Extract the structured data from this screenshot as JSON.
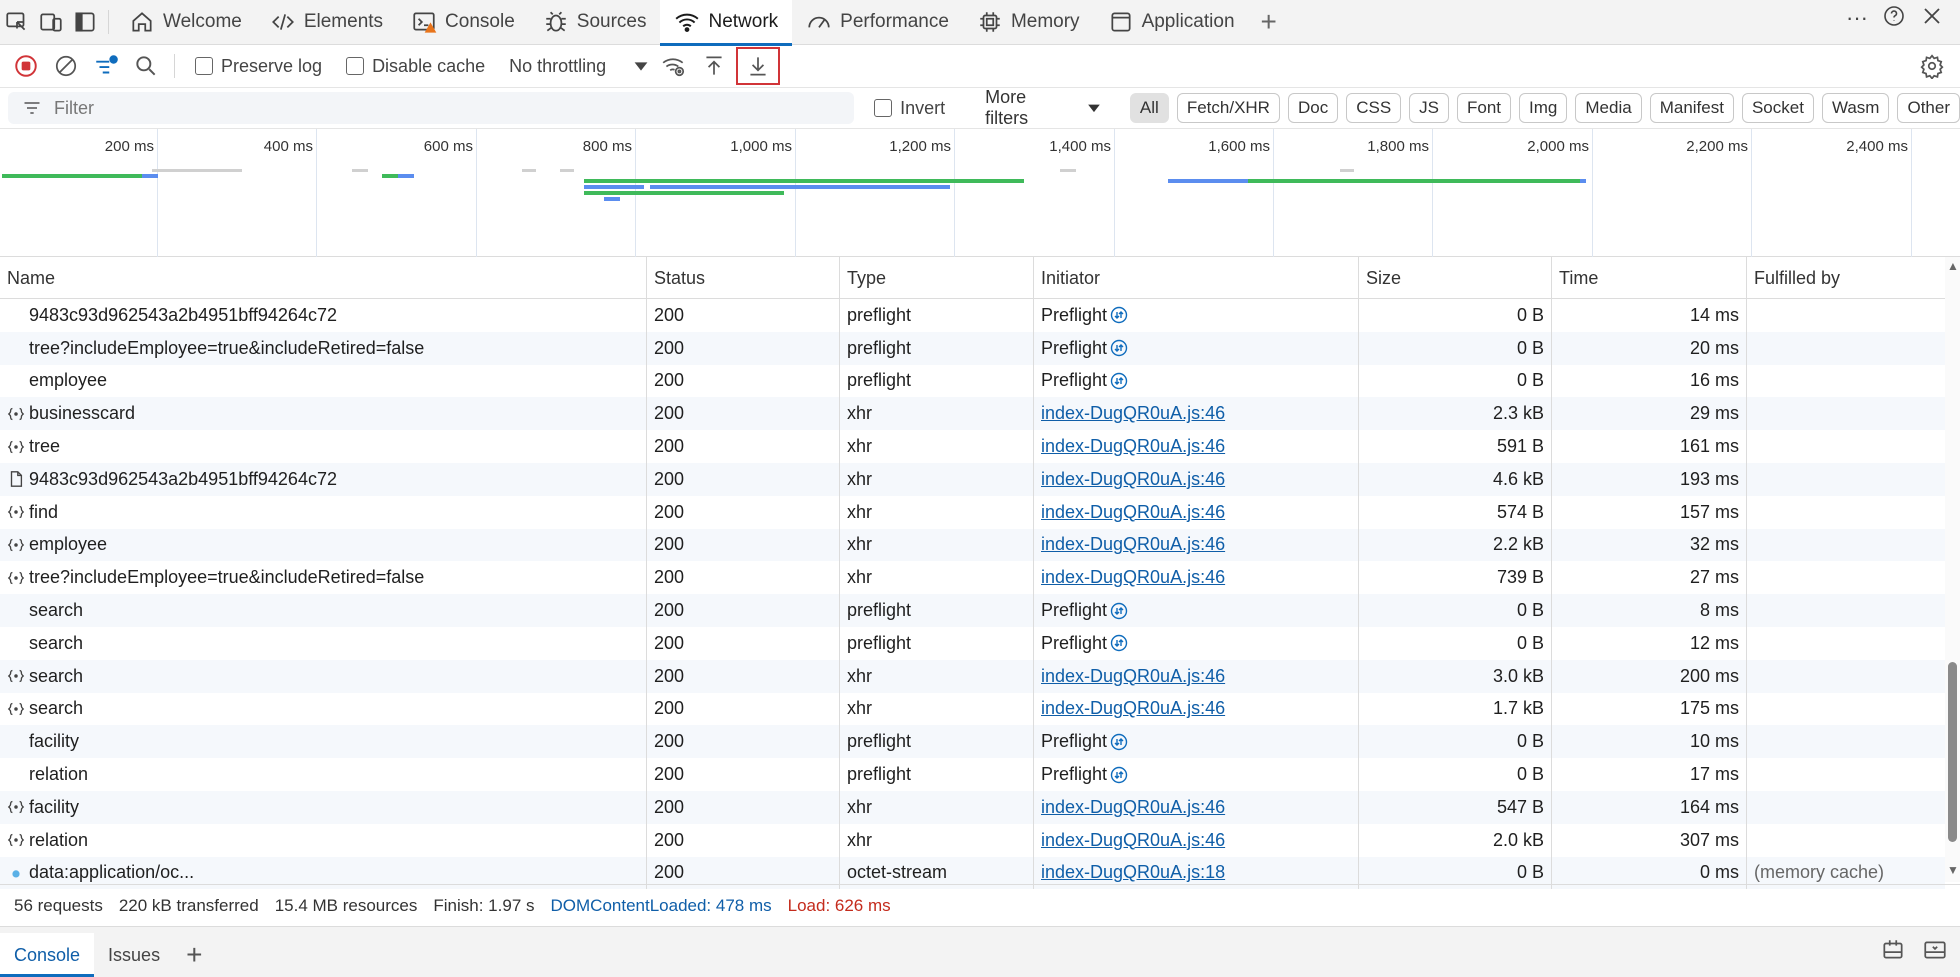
{
  "tabs": [
    {
      "label": "Welcome",
      "icon": "home-icon"
    },
    {
      "label": "Elements",
      "icon": "code-icon"
    },
    {
      "label": "Console",
      "icon": "console-icon"
    },
    {
      "label": "Sources",
      "icon": "bug-icon"
    },
    {
      "label": "Network",
      "icon": "wifi-icon"
    },
    {
      "label": "Performance",
      "icon": "gauge-icon"
    },
    {
      "label": "Memory",
      "icon": "chip-icon"
    },
    {
      "label": "Application",
      "icon": "window-icon"
    }
  ],
  "toolbar": {
    "preserve_log": "Preserve log",
    "disable_cache": "Disable cache",
    "throttling": "No throttling"
  },
  "filterbar": {
    "filter_placeholder": "Filter",
    "invert": "Invert",
    "more_filters": "More filters",
    "chips": [
      "All",
      "Fetch/XHR",
      "Doc",
      "CSS",
      "JS",
      "Font",
      "Img",
      "Media",
      "Manifest",
      "Socket",
      "Wasm",
      "Other"
    ]
  },
  "overview": {
    "ticks": [
      "200 ms",
      "400 ms",
      "600 ms",
      "800 ms",
      "1,000 ms",
      "1,200 ms",
      "1,400 ms",
      "1,600 ms",
      "1,800 ms",
      "2,000 ms",
      "2,200 ms",
      "2,400 ms"
    ]
  },
  "columns": {
    "name": "Name",
    "status": "Status",
    "type": "Type",
    "initiator": "Initiator",
    "size": "Size",
    "time": "Time",
    "fulfilled": "Fulfilled by"
  },
  "rows": [
    {
      "icon": "none",
      "name": "9483c93d962543a2b4951bff94264c72",
      "status": "200",
      "type": "preflight",
      "initiator": "Preflight",
      "initiator_kind": "preflight",
      "size": "0 B",
      "time": "14 ms",
      "fulfilled": ""
    },
    {
      "icon": "none",
      "name": "tree?includeEmployee=true&includeRetired=false",
      "status": "200",
      "type": "preflight",
      "initiator": "Preflight",
      "initiator_kind": "preflight",
      "size": "0 B",
      "time": "20 ms",
      "fulfilled": ""
    },
    {
      "icon": "none",
      "name": "employee",
      "status": "200",
      "type": "preflight",
      "initiator": "Preflight",
      "initiator_kind": "preflight",
      "size": "0 B",
      "time": "16 ms",
      "fulfilled": ""
    },
    {
      "icon": "xhr",
      "name": "businesscard",
      "status": "200",
      "type": "xhr",
      "initiator": "index-DugQR0uA.js:46",
      "initiator_kind": "link",
      "size": "2.3 kB",
      "time": "29 ms",
      "fulfilled": ""
    },
    {
      "icon": "xhr",
      "name": "tree",
      "status": "200",
      "type": "xhr",
      "initiator": "index-DugQR0uA.js:46",
      "initiator_kind": "link",
      "size": "591 B",
      "time": "161 ms",
      "fulfilled": ""
    },
    {
      "icon": "doc",
      "name": "9483c93d962543a2b4951bff94264c72",
      "status": "200",
      "type": "xhr",
      "initiator": "index-DugQR0uA.js:46",
      "initiator_kind": "link",
      "size": "4.6 kB",
      "time": "193 ms",
      "fulfilled": ""
    },
    {
      "icon": "xhr",
      "name": "find",
      "status": "200",
      "type": "xhr",
      "initiator": "index-DugQR0uA.js:46",
      "initiator_kind": "link",
      "size": "574 B",
      "time": "157 ms",
      "fulfilled": ""
    },
    {
      "icon": "xhr",
      "name": "employee",
      "status": "200",
      "type": "xhr",
      "initiator": "index-DugQR0uA.js:46",
      "initiator_kind": "link",
      "size": "2.2 kB",
      "time": "32 ms",
      "fulfilled": ""
    },
    {
      "icon": "xhr",
      "name": "tree?includeEmployee=true&includeRetired=false",
      "status": "200",
      "type": "xhr",
      "initiator": "index-DugQR0uA.js:46",
      "initiator_kind": "link",
      "size": "739 B",
      "time": "27 ms",
      "fulfilled": ""
    },
    {
      "icon": "none",
      "name": "search",
      "status": "200",
      "type": "preflight",
      "initiator": "Preflight",
      "initiator_kind": "preflight",
      "size": "0 B",
      "time": "8 ms",
      "fulfilled": ""
    },
    {
      "icon": "none",
      "name": "search",
      "status": "200",
      "type": "preflight",
      "initiator": "Preflight",
      "initiator_kind": "preflight",
      "size": "0 B",
      "time": "12 ms",
      "fulfilled": ""
    },
    {
      "icon": "xhr",
      "name": "search",
      "status": "200",
      "type": "xhr",
      "initiator": "index-DugQR0uA.js:46",
      "initiator_kind": "link",
      "size": "3.0 kB",
      "time": "200 ms",
      "fulfilled": ""
    },
    {
      "icon": "xhr",
      "name": "search",
      "status": "200",
      "type": "xhr",
      "initiator": "index-DugQR0uA.js:46",
      "initiator_kind": "link",
      "size": "1.7 kB",
      "time": "175 ms",
      "fulfilled": ""
    },
    {
      "icon": "none",
      "name": "facility",
      "status": "200",
      "type": "preflight",
      "initiator": "Preflight",
      "initiator_kind": "preflight",
      "size": "0 B",
      "time": "10 ms",
      "fulfilled": ""
    },
    {
      "icon": "none",
      "name": "relation",
      "status": "200",
      "type": "preflight",
      "initiator": "Preflight",
      "initiator_kind": "preflight",
      "size": "0 B",
      "time": "17 ms",
      "fulfilled": ""
    },
    {
      "icon": "xhr",
      "name": "facility",
      "status": "200",
      "type": "xhr",
      "initiator": "index-DugQR0uA.js:46",
      "initiator_kind": "link",
      "size": "547 B",
      "time": "164 ms",
      "fulfilled": ""
    },
    {
      "icon": "xhr",
      "name": "relation",
      "status": "200",
      "type": "xhr",
      "initiator": "index-DugQR0uA.js:46",
      "initiator_kind": "link",
      "size": "2.0 kB",
      "time": "307 ms",
      "fulfilled": ""
    },
    {
      "icon": "data",
      "name": "data:application/oc...",
      "status": "200",
      "type": "octet-stream",
      "initiator": "index-DugQR0uA.js:18",
      "initiator_kind": "link",
      "size": "0 B",
      "time": "0 ms",
      "fulfilled": "(memory cache)"
    }
  ],
  "statusbar": {
    "requests": "56 requests",
    "transferred": "220 kB transferred",
    "resources": "15.4 MB resources",
    "finish": "Finish: 1.97 s",
    "dom_loaded": "DOMContentLoaded: 478 ms",
    "load": "Load: 626 ms"
  },
  "drawer": {
    "tabs": [
      "Console",
      "Issues"
    ]
  },
  "colors": {
    "accent": "#0f6cbd",
    "dom_loaded": "#0f5ea8",
    "load": "#c42b1c",
    "waterfall_green": "#3fba5a",
    "waterfall_blue": "#5b8def"
  }
}
